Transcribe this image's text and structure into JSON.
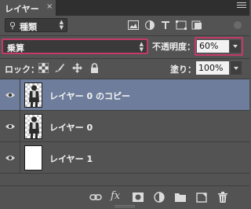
{
  "panel": {
    "tab_label": "レイヤー",
    "tab_close": "×"
  },
  "filter": {
    "kind_label": "種類",
    "icons": [
      "image-filter-icon",
      "adjustment-filter-icon",
      "type-filter-icon",
      "shape-filter-icon",
      "smart-object-filter-icon",
      "filter-toggle"
    ]
  },
  "blend": {
    "mode": "乗算",
    "opacity_label": "不透明度：",
    "opacity_value": "60%"
  },
  "lock": {
    "label": "ロック：",
    "icons": [
      "lock-transparent-icon",
      "lock-image-icon",
      "lock-position-icon",
      "lock-all-icon"
    ],
    "fill_label": "塗り：",
    "fill_value": "100%"
  },
  "layers": [
    {
      "name": "レイヤー 0 のコピー",
      "selected": true,
      "visible": true,
      "thumb": "photo"
    },
    {
      "name": "レイヤー 0",
      "selected": false,
      "visible": true,
      "thumb": "photo"
    },
    {
      "name": "レイヤー 1",
      "selected": false,
      "visible": true,
      "thumb": "white"
    }
  ],
  "footer": {
    "icons": [
      "link-icon",
      "fx-icon",
      "mask-icon",
      "adjustment-icon",
      "folder-icon",
      "new-layer-icon",
      "trash-icon"
    ],
    "fx_label": "fx"
  },
  "colors": {
    "panel_bg": "#535353",
    "selected_row": "#6d7d9b",
    "highlight_border": "#c23a6a"
  }
}
